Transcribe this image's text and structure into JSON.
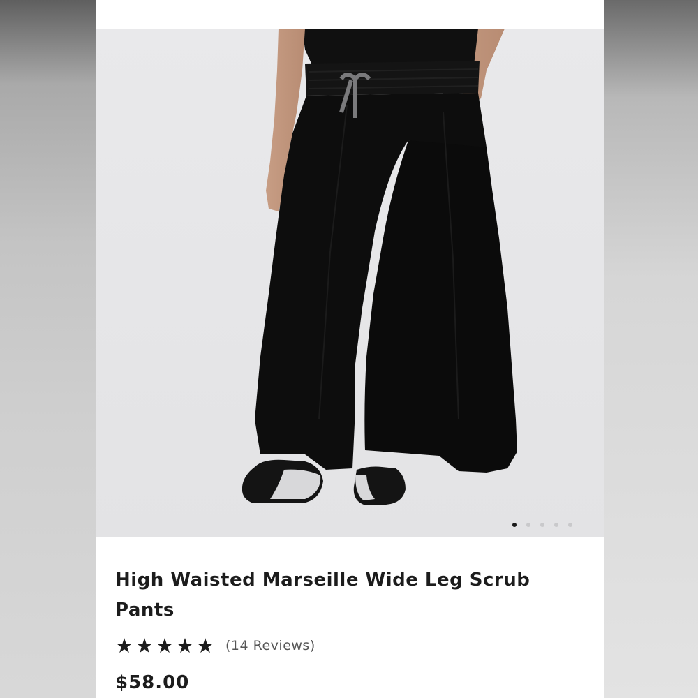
{
  "product": {
    "image_alt": "Black high waisted wide leg scrub pants",
    "title": "High Waisted Marseille Wide Leg Scrub Pants",
    "rating_stars": 5,
    "rating_glyph": "★",
    "reviews_open": "(",
    "reviews_label": "14 Reviews",
    "reviews_close": ")",
    "price": "$58.00"
  },
  "carousel": {
    "total_images": 5,
    "active_index": 0
  },
  "colors": {
    "pants": "#0d0d0d",
    "photo_bg": "#e6e6e8",
    "text": "#1c1c1c",
    "link": "#555555"
  }
}
